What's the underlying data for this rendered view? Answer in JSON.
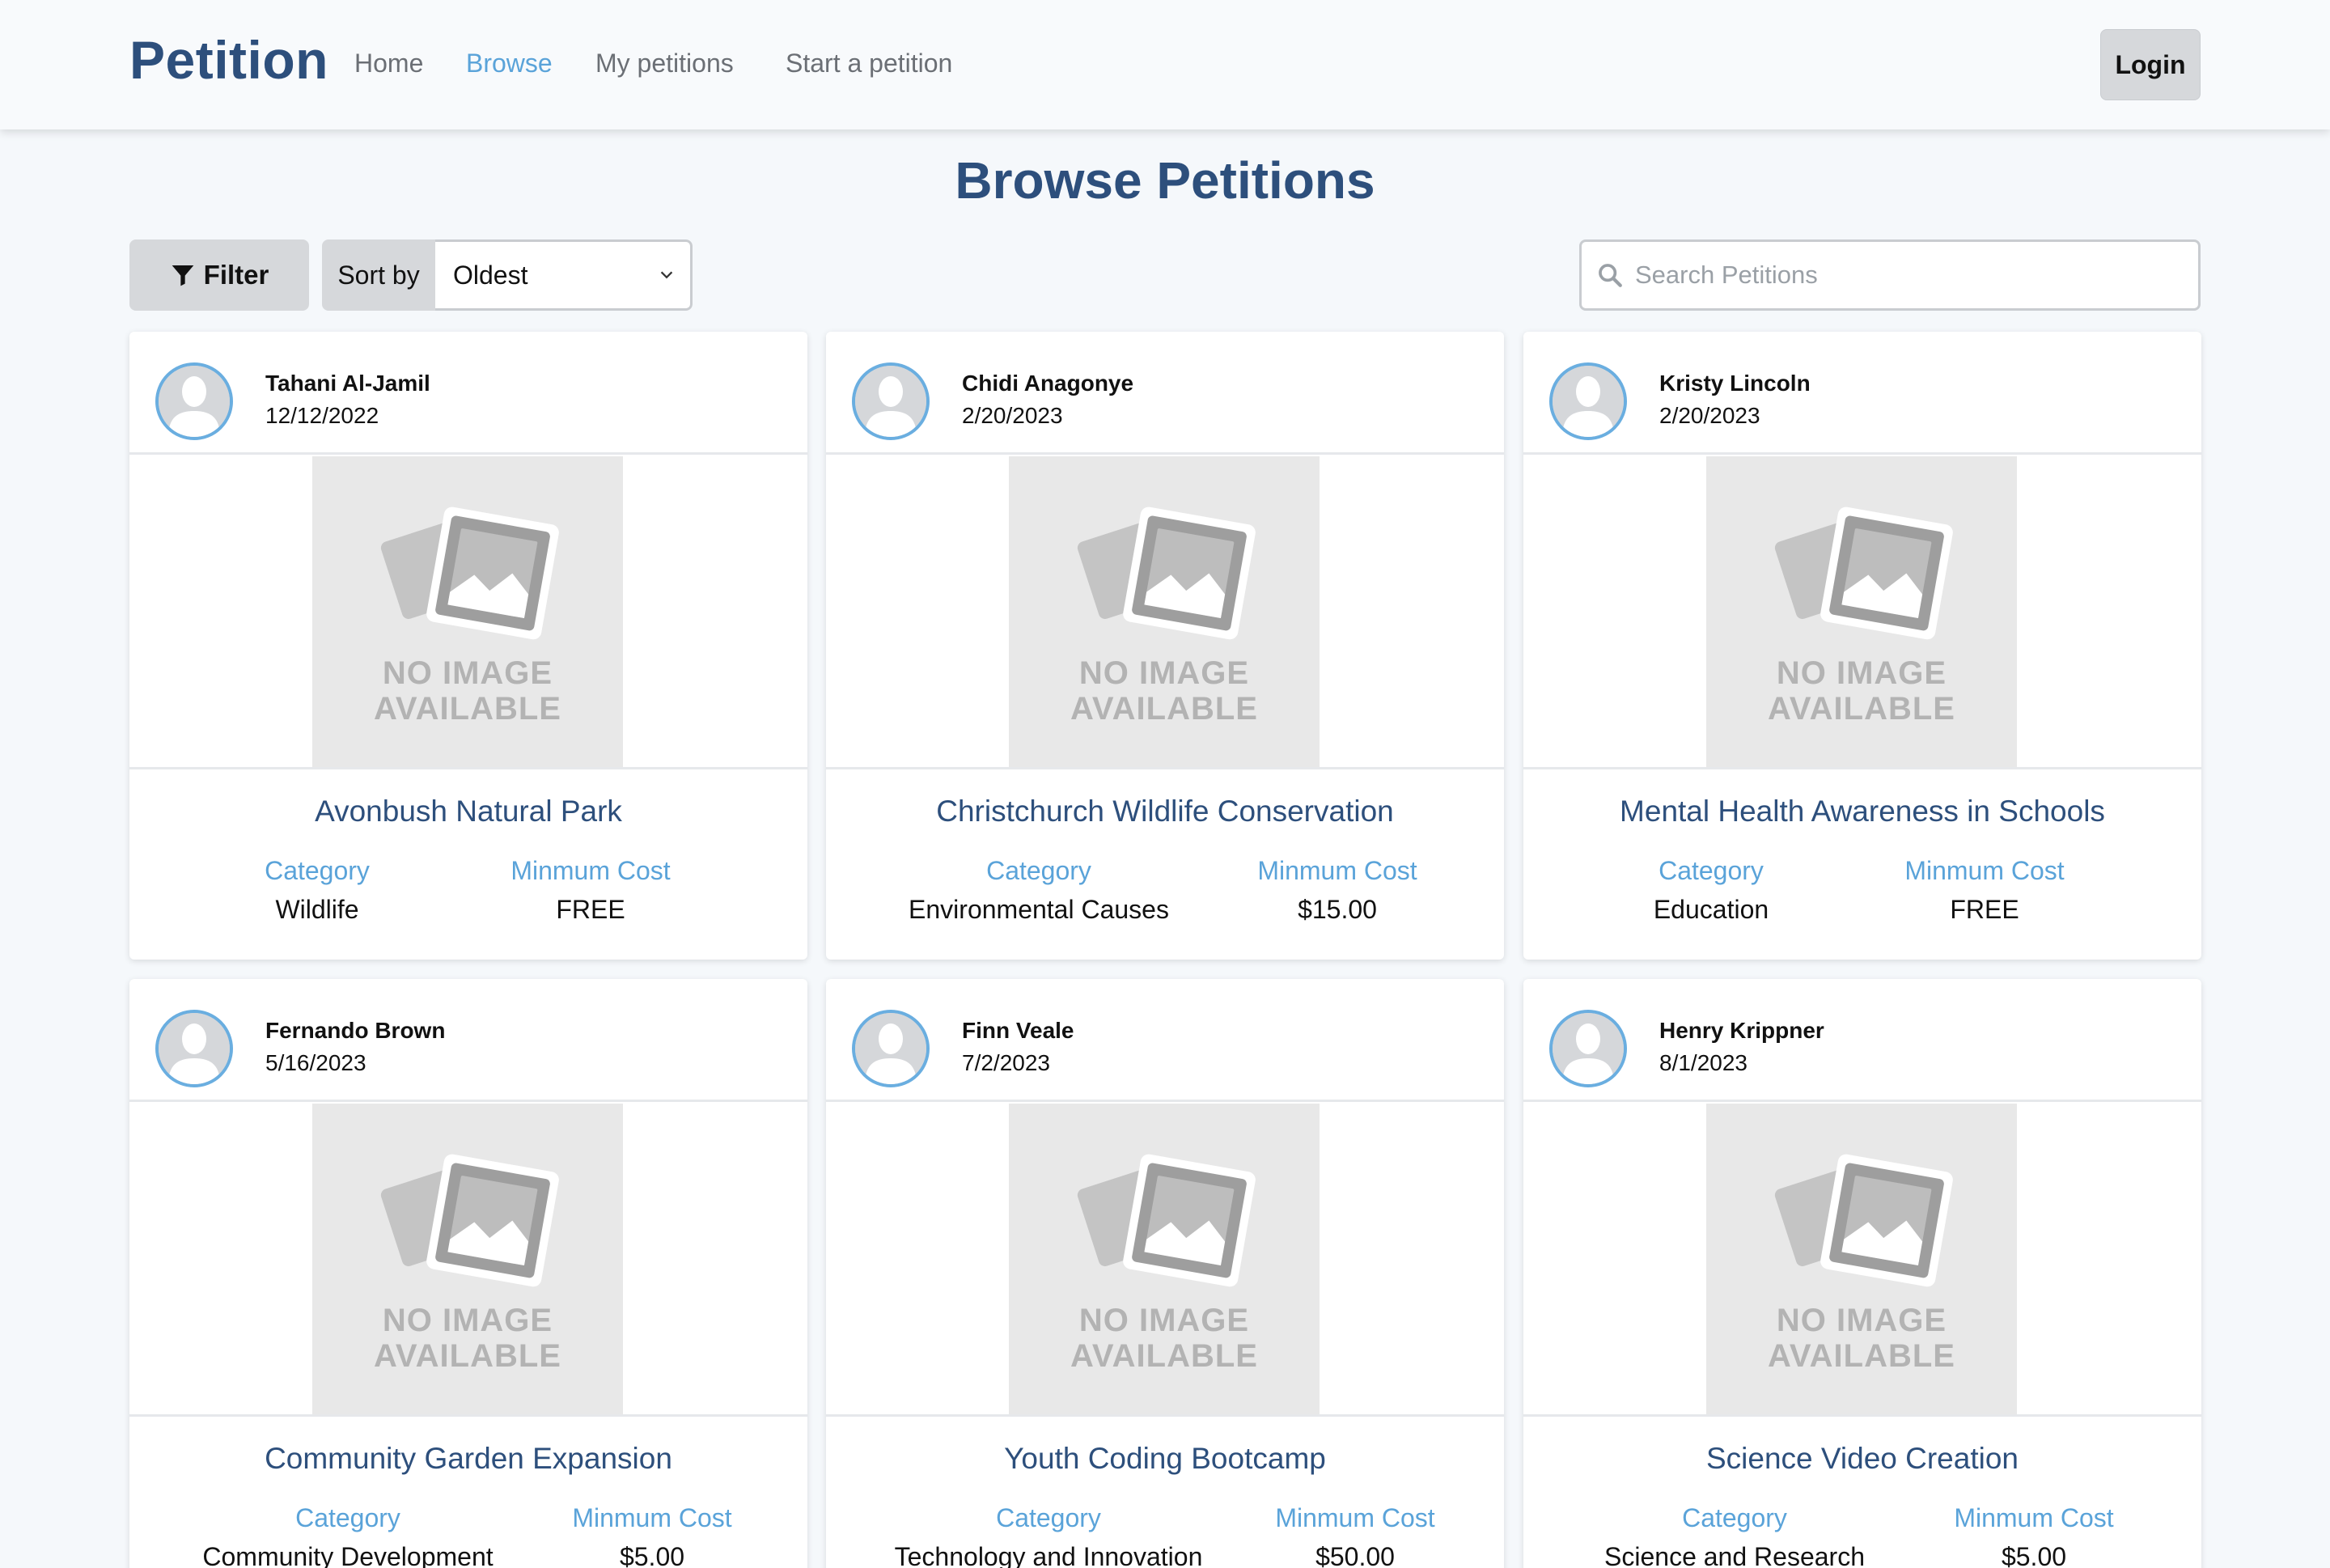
{
  "nav": {
    "brand": "Petition",
    "links": [
      "Home",
      "Browse",
      "My petitions",
      "Start a petition"
    ],
    "login": "Login",
    "active_color": "#5aa3d9"
  },
  "header": {
    "title": "Browse Petitions"
  },
  "toolbar": {
    "filter_label": "Filter",
    "sort_label": "Sort by",
    "sort_value": "Oldest",
    "search_placeholder": "Search Petitions"
  },
  "card_labels": {
    "category": "Category",
    "min_cost": "Minmum Cost",
    "no_image_line1": "NO IMAGE",
    "no_image_line2": "AVAILABLE"
  },
  "petitions": [
    {
      "owner": "Tahani Al-Jamil",
      "date": "12/12/2022",
      "title": "Avonbush Natural Park",
      "category": "Wildlife",
      "cost": "FREE"
    },
    {
      "owner": "Chidi Anagonye",
      "date": "2/20/2023",
      "title": "Christchurch Wildlife Conservation",
      "category": "Environmental Causes",
      "cost": "$15.00"
    },
    {
      "owner": "Kristy Lincoln",
      "date": "2/20/2023",
      "title": "Mental Health Awareness in Schools",
      "category": "Education",
      "cost": "FREE"
    },
    {
      "owner": "Fernando Brown",
      "date": "5/16/2023",
      "title": "Community Garden Expansion",
      "category": "Community Development",
      "cost": "$5.00"
    },
    {
      "owner": "Finn Veale",
      "date": "7/2/2023",
      "title": "Youth Coding Bootcamp",
      "category": "Technology and Innovation",
      "cost": "$50.00"
    },
    {
      "owner": "Henry Krippner",
      "date": "8/1/2023",
      "title": "Science Video Creation",
      "category": "Science and Research",
      "cost": "$5.00"
    }
  ]
}
